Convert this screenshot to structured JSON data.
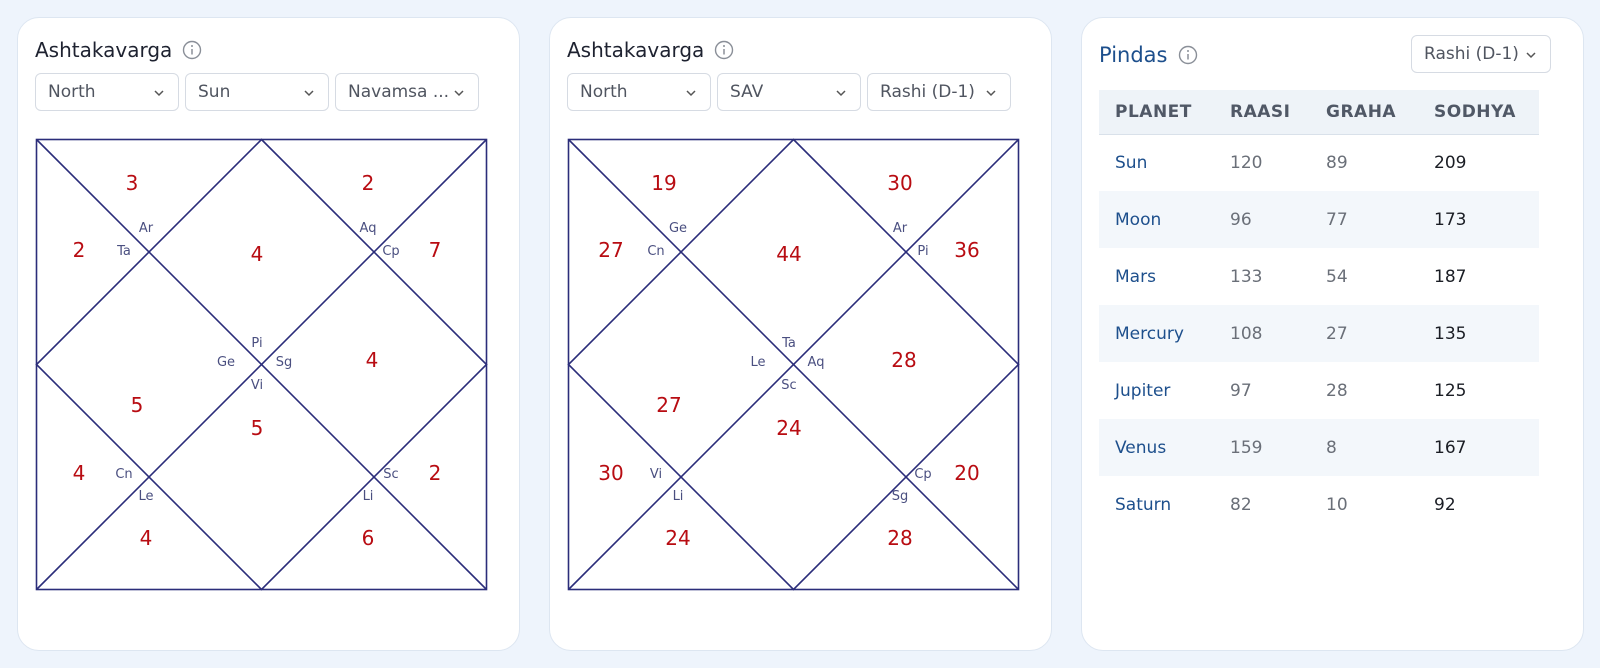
{
  "colors": {
    "chart_line": "#2b2d7a",
    "value_red": "#b80c12",
    "sign_text": "#4a4f80",
    "pindas_accent": "#1d4f8c"
  },
  "card1": {
    "title": "Ashtakavarga",
    "selects": [
      "North",
      "Sun",
      "Navamsa ..."
    ],
    "chart": {
      "values": [
        "3",
        "2",
        "2",
        "4",
        "7",
        "4",
        "5",
        "5",
        "4",
        "2",
        "4",
        "6"
      ],
      "signs": [
        "Ar",
        "Ta",
        "Aq",
        "Cp",
        "Pi",
        "Ge",
        "Sg",
        "Vi",
        "Cn",
        "Le",
        "Sc",
        "Li"
      ]
    }
  },
  "card2": {
    "title": "Ashtakavarga",
    "selects": [
      "North",
      "SAV",
      "Rashi (D-1)"
    ],
    "chart": {
      "values": [
        "19",
        "30",
        "27",
        "44",
        "36",
        "28",
        "27",
        "24",
        "30",
        "20",
        "24",
        "28"
      ],
      "signs": [
        "Ge",
        "Cn",
        "Ar",
        "Pi",
        "Ta",
        "Le",
        "Aq",
        "Sc",
        "Vi",
        "Li",
        "Cp",
        "Sg"
      ]
    }
  },
  "pindas": {
    "title": "Pindas",
    "select": "Rashi (D-1)",
    "headers": [
      "PLANET",
      "RAASI",
      "GRAHA",
      "SODHYA"
    ],
    "rows": [
      [
        "Sun",
        "120",
        "89",
        "209"
      ],
      [
        "Moon",
        "96",
        "77",
        "173"
      ],
      [
        "Mars",
        "133",
        "54",
        "187"
      ],
      [
        "Mercury",
        "108",
        "27",
        "135"
      ],
      [
        "Jupiter",
        "97",
        "28",
        "125"
      ],
      [
        "Venus",
        "159",
        "8",
        "167"
      ],
      [
        "Saturn",
        "82",
        "10",
        "92"
      ]
    ]
  }
}
